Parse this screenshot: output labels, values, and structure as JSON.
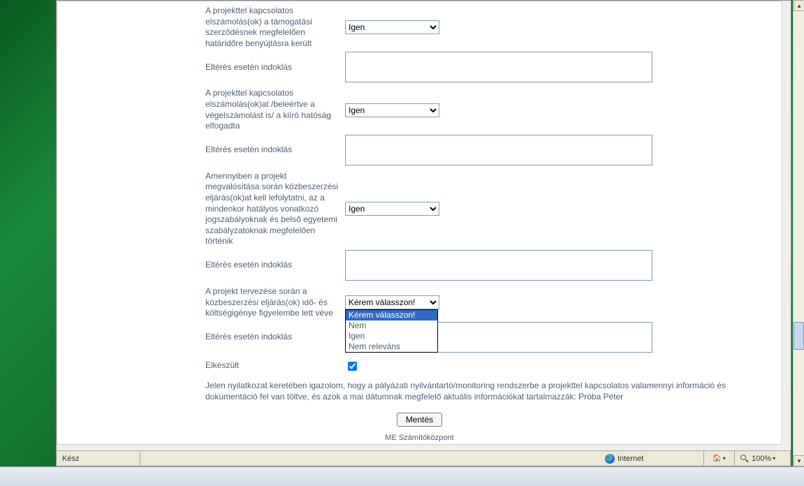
{
  "form": {
    "row1": {
      "label": "A projekttel kapcsolatos elszámolás(ok) a támogatási szerződésnek megfelelően határidőre benyújtásra került",
      "value": "Igen"
    },
    "row2": {
      "label": "Eltérés esetén indoklás",
      "value": ""
    },
    "row3": {
      "label": "A projekttel kapcsolatos elszámolás(ok)at /beleértve a végelszámolást is/ a kiíró hatóság elfogadta",
      "value": "Igen"
    },
    "row4": {
      "label": "Eltérés esetén indoklás",
      "value": ""
    },
    "row5": {
      "label": "Amennyiben a projekt megvalósítása során közbeszerzési eljárás(ok)at kell lefolytatni, az a mindenkor hatályos vonatkozó jogszabályoknak és belső egyetemi szabályzatoknak megfelelően történik",
      "value": "Igen"
    },
    "row6": {
      "label": "Eltérés esetén indoklás",
      "value": ""
    },
    "row7": {
      "label": "A projekt tervezése során a közbeszerzési eljárás(ok) idő- és költségigénye figyelembe lett véve",
      "value": "Kérem válasszon!"
    },
    "row8": {
      "label": "Eltérés esetén indoklás",
      "value": ""
    },
    "row9": {
      "label": "Elkészült"
    },
    "select_options": {
      "opt0": "Kérem válasszon!",
      "opt1": "Nem",
      "opt2": "Igen",
      "opt3": "Nem releváns"
    }
  },
  "declaration": "Jelen nyilatkozat keretében igazolom, hogy a pályázati nyilvántartó/monitoring rendszerbe a projekttel kapcsolatos valamennyi információ és dokumentáció fel van töltve, és azok a mai dátumnak megfelelő aktuális információkat tartalmazzák: Próba Péter",
  "buttons": {
    "save": "Mentés"
  },
  "footer": "ME Számítóközpont",
  "statusbar": {
    "ready": "Kész",
    "zone": "Internet",
    "zoom": "100%"
  },
  "taskbar": {
    "start": ""
  }
}
